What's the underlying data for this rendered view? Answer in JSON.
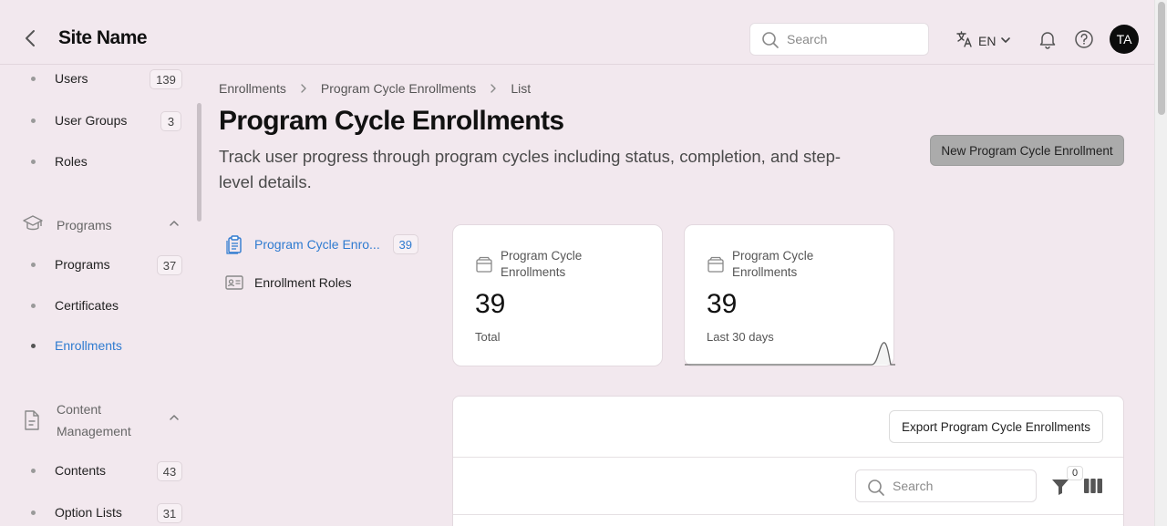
{
  "header": {
    "site_name": "Site Name",
    "search_placeholder": "Search",
    "language": "EN",
    "avatar_initials": "TA"
  },
  "sidebar": {
    "items_top": [
      {
        "label": "Users",
        "count": "139"
      },
      {
        "label": "User Groups",
        "count": "3"
      },
      {
        "label": "Roles"
      }
    ],
    "programs_group": {
      "label": "Programs",
      "items": [
        {
          "label": "Programs",
          "count": "37"
        },
        {
          "label": "Certificates"
        },
        {
          "label": "Enrollments",
          "active": true
        }
      ]
    },
    "content_group": {
      "label_line1": "Content",
      "label_line2": "Management",
      "items": [
        {
          "label": "Contents",
          "count": "43"
        },
        {
          "label": "Option Lists",
          "count": "31"
        }
      ]
    }
  },
  "breadcrumb": [
    "Enrollments",
    "Program Cycle Enrollments",
    "List"
  ],
  "page": {
    "title": "Program Cycle Enrollments",
    "description": "Track user progress through program cycles including status, completion, and step-level details.",
    "new_button": "New Program Cycle Enrollment"
  },
  "subnav": [
    {
      "label": "Program Cycle Enro...",
      "count": "39",
      "active": true
    },
    {
      "label": "Enrollment Roles"
    }
  ],
  "stats": [
    {
      "label": "Program Cycle Enrollments",
      "value": "39",
      "sub": "Total"
    },
    {
      "label": "Program Cycle Enrollments",
      "value": "39",
      "sub": "Last 30 days"
    }
  ],
  "table": {
    "export_button": "Export Program Cycle Enrollments",
    "search_placeholder": "Search",
    "filter_count": "0"
  },
  "colors": {
    "background": "#f2e8ee",
    "accent": "#2f7bd0",
    "primary_button": "#ababab"
  }
}
